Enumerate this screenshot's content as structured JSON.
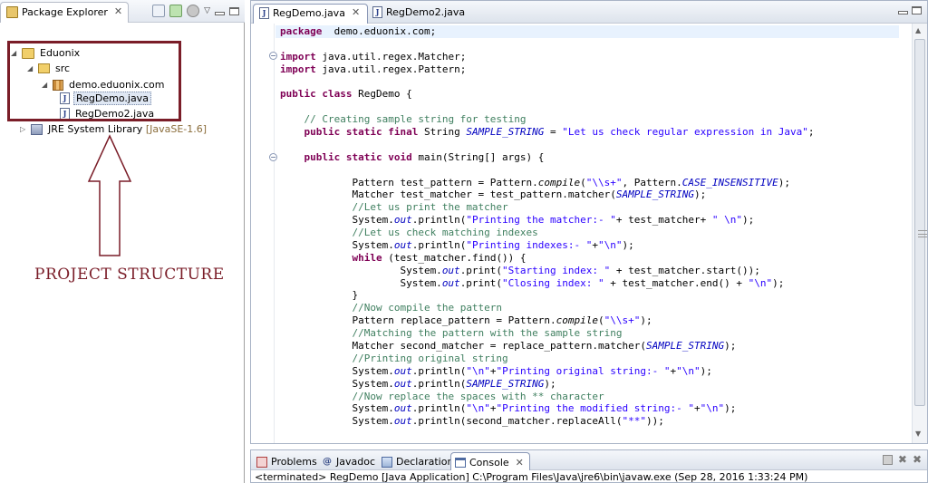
{
  "package_explorer": {
    "tab_label": "Package Explorer",
    "tree": {
      "project": "Eduonix",
      "src": "src",
      "package": "demo.eduonix.com",
      "files": [
        "RegDemo.java",
        "RegDemo2.java"
      ],
      "jre_label": "JRE System Library",
      "jre_version": "[JavaSE-1.6]"
    }
  },
  "annotation": {
    "caption": "PROJECT STRUCTURE",
    "color": "#7a1d28"
  },
  "editor": {
    "tabs": [
      {
        "label": "RegDemo.java",
        "active": true
      },
      {
        "label": "RegDemo2.java",
        "active": false
      }
    ]
  },
  "code_lines": [
    [
      [
        "kw",
        "package"
      ],
      [
        "",
        "  demo.eduonix.com;"
      ]
    ],
    [],
    [
      [
        "kw",
        "import"
      ],
      [
        "",
        " java.util.regex.Matcher;"
      ]
    ],
    [
      [
        "kw",
        "import"
      ],
      [
        "",
        " java.util.regex.Pattern;"
      ]
    ],
    [],
    [
      [
        "kw",
        "public class"
      ],
      [
        "",
        " RegDemo {"
      ]
    ],
    [],
    [
      [
        "",
        "    "
      ],
      [
        "cm",
        "// Creating sample string for testing"
      ]
    ],
    [
      [
        "",
        "    "
      ],
      [
        "kw",
        "public static final"
      ],
      [
        "",
        " String "
      ],
      [
        "fi",
        "SAMPLE_STRING"
      ],
      [
        "",
        " = "
      ],
      [
        "st",
        "\"Let us check regular expression in Java\""
      ],
      [
        "",
        ";"
      ]
    ],
    [],
    [
      [
        "",
        "    "
      ],
      [
        "kw",
        "public static void"
      ],
      [
        "",
        " main(String[] args) {"
      ]
    ],
    [],
    [
      [
        "",
        "            Pattern test_pattern = Pattern."
      ],
      [
        "mi",
        "compile"
      ],
      [
        "",
        "("
      ],
      [
        "st",
        "\"\\\\s+\""
      ],
      [
        "",
        ", Pattern."
      ],
      [
        "fi",
        "CASE_INSENSITIVE"
      ],
      [
        "",
        ");"
      ]
    ],
    [
      [
        "",
        "            Matcher test_matcher = test_pattern.matcher("
      ],
      [
        "fi",
        "SAMPLE_STRING"
      ],
      [
        "",
        ");"
      ]
    ],
    [
      [
        "",
        "            "
      ],
      [
        "cm",
        "//Let us print the matcher"
      ]
    ],
    [
      [
        "",
        "            System."
      ],
      [
        "fi",
        "out"
      ],
      [
        "",
        ".println("
      ],
      [
        "st",
        "\"Printing the matcher:- \""
      ],
      [
        "",
        "+ test_matcher+ "
      ],
      [
        "st",
        "\" \\n\""
      ],
      [
        "",
        ");"
      ]
    ],
    [
      [
        "",
        "            "
      ],
      [
        "cm",
        "//Let us check matching indexes"
      ]
    ],
    [
      [
        "",
        "            System."
      ],
      [
        "fi",
        "out"
      ],
      [
        "",
        ".println("
      ],
      [
        "st",
        "\"Printing indexes:- \""
      ],
      [
        "",
        "+"
      ],
      [
        "st",
        "\"\\n\""
      ],
      [
        "",
        ");"
      ]
    ],
    [
      [
        "",
        "            "
      ],
      [
        "kw",
        "while"
      ],
      [
        "",
        " (test_matcher.find()) {"
      ]
    ],
    [
      [
        "",
        "                    System."
      ],
      [
        "fi",
        "out"
      ],
      [
        "",
        ".print("
      ],
      [
        "st",
        "\"Starting index: \""
      ],
      [
        "",
        " + test_matcher.start());"
      ]
    ],
    [
      [
        "",
        "                    System."
      ],
      [
        "fi",
        "out"
      ],
      [
        "",
        ".print("
      ],
      [
        "st",
        "\"Closing index: \""
      ],
      [
        "",
        " + test_matcher.end() + "
      ],
      [
        "st",
        "\"\\n\""
      ],
      [
        "",
        ");"
      ]
    ],
    [
      [
        "",
        "            }"
      ]
    ],
    [
      [
        "",
        "            "
      ],
      [
        "cm",
        "//Now compile the pattern"
      ]
    ],
    [
      [
        "",
        "            Pattern replace_pattern = Pattern."
      ],
      [
        "mi",
        "compile"
      ],
      [
        "",
        "("
      ],
      [
        "st",
        "\"\\\\s+\""
      ],
      [
        "",
        ");"
      ]
    ],
    [
      [
        "",
        "            "
      ],
      [
        "cm",
        "//Matching the pattern with the sample string"
      ]
    ],
    [
      [
        "",
        "            Matcher second_matcher = replace_pattern.matcher("
      ],
      [
        "fi",
        "SAMPLE_STRING"
      ],
      [
        "",
        ");"
      ]
    ],
    [
      [
        "",
        "            "
      ],
      [
        "cm",
        "//Printing original string"
      ]
    ],
    [
      [
        "",
        "            System."
      ],
      [
        "fi",
        "out"
      ],
      [
        "",
        ".println("
      ],
      [
        "st",
        "\"\\n\""
      ],
      [
        "",
        "+"
      ],
      [
        "st",
        "\"Printing original string:- \""
      ],
      [
        "",
        "+"
      ],
      [
        "st",
        "\"\\n\""
      ],
      [
        "",
        ");"
      ]
    ],
    [
      [
        "",
        "            System."
      ],
      [
        "fi",
        "out"
      ],
      [
        "",
        ".println("
      ],
      [
        "fi",
        "SAMPLE_STRING"
      ],
      [
        "",
        ");"
      ]
    ],
    [
      [
        "",
        "            "
      ],
      [
        "cm",
        "//Now replace the spaces with ** character"
      ]
    ],
    [
      [
        "",
        "            System."
      ],
      [
        "fi",
        "out"
      ],
      [
        "",
        ".println("
      ],
      [
        "st",
        "\"\\n\""
      ],
      [
        "",
        "+"
      ],
      [
        "st",
        "\"Printing the modified string:- \""
      ],
      [
        "",
        "+"
      ],
      [
        "st",
        "\"\\n\""
      ],
      [
        "",
        ");"
      ]
    ],
    [
      [
        "",
        "            System."
      ],
      [
        "fi",
        "out"
      ],
      [
        "",
        ".println(second_matcher.replaceAll("
      ],
      [
        "st",
        "\"**\""
      ],
      [
        "",
        "));"
      ]
    ]
  ],
  "bottom_panel": {
    "tabs": [
      "Problems",
      "Javadoc",
      "Declaration",
      "Console"
    ],
    "active_tab": "Console",
    "status": "<terminated> RegDemo [Java Application] C:\\Program Files\\Java\\jre6\\bin\\javaw.exe (Sep 28, 2016 1:33:24 PM)"
  }
}
